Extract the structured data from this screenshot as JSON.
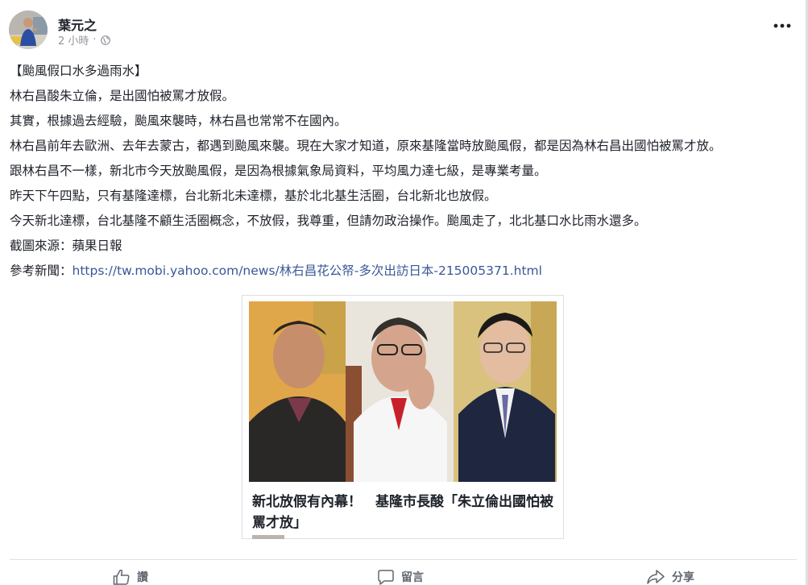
{
  "post": {
    "author": "葉元之",
    "time": "2 小時",
    "separator": "·",
    "audience_icon": "globe-icon",
    "menu_icon": "more-options-icon",
    "lines": [
      "【颱風假口水多過雨水】",
      "林右昌酸朱立倫，是出國怕被罵才放假。",
      "其實，根據過去經驗，颱風來襲時，林右昌也常常不在國內。",
      "林右昌前年去歐洲、去年去蒙古，都遇到颱風來襲。現在大家才知道，原來基隆當時放颱風假，都是因為林右昌出國怕被罵才放。",
      "跟林右昌不一樣，新北市今天放颱風假，是因為根據氣象局資料，平均風力達七級，是專業考量。",
      "昨天下午四點，只有基隆達標，台北新北未達標，基於北北基生活圈，台北新北也放假。",
      "今天新北達標，台北基隆不顧生活圈概念，不放假，我尊重，但請勿政治操作。颱風走了，北北基口水比雨水還多。",
      "截圖來源：蘋果日報"
    ],
    "ref_label": "參考新聞：",
    "ref_url": "https://tw.mobi.yahoo.com/news/林右昌花公帑-多次出訪日本-215005371.html"
  },
  "card": {
    "title": "新北放假有內幕！　基隆市長酸「朱立倫出國怕被罵才放」"
  },
  "actions": {
    "like": "讚",
    "comment": "留言",
    "share": "分享"
  },
  "colors": {
    "link": "#385898",
    "meta": "#90949c",
    "action": "#606770"
  }
}
